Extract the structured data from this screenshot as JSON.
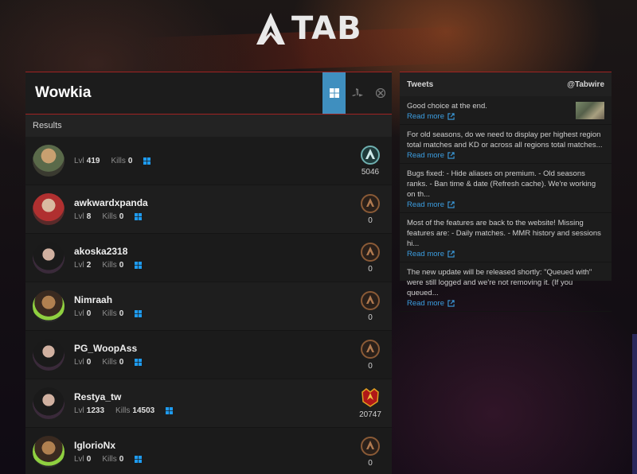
{
  "logo": {
    "text": "TAB"
  },
  "search": {
    "value": "Wowkia",
    "placeholder": ""
  },
  "platforms": [
    {
      "name": "PC",
      "active": true
    },
    {
      "name": "PlayStation",
      "active": false
    },
    {
      "name": "Xbox",
      "active": false
    }
  ],
  "results": {
    "header": "Results",
    "lvl_label": "Lvl",
    "kills_label": "Kills",
    "players": [
      {
        "name": "",
        "lvl": "419",
        "kills": "0",
        "rank": "5046",
        "rank_tier": "master"
      },
      {
        "name": "awkwardxpanda",
        "lvl": "8",
        "kills": "0",
        "rank": "0",
        "rank_tier": "rookie"
      },
      {
        "name": "akoska2318",
        "lvl": "2",
        "kills": "0",
        "rank": "0",
        "rank_tier": "rookie"
      },
      {
        "name": "Nimraah",
        "lvl": "0",
        "kills": "0",
        "rank": "0",
        "rank_tier": "rookie"
      },
      {
        "name": "PG_WoopAss",
        "lvl": "0",
        "kills": "0",
        "rank": "0",
        "rank_tier": "rookie"
      },
      {
        "name": "Restya_tw",
        "lvl": "1233",
        "kills": "14503",
        "rank": "20747",
        "rank_tier": "predator"
      },
      {
        "name": "IglorioNx",
        "lvl": "0",
        "kills": "0",
        "rank": "0",
        "rank_tier": "rookie"
      }
    ]
  },
  "tweets": {
    "title": "Tweets",
    "handle": "@Tabwire",
    "read_more": "Read more",
    "items": [
      {
        "text": "Good choice at the end."
      },
      {
        "text": "For old seasons, do we need to display per highest region total matches and KD or across all regions total matches..."
      },
      {
        "text": "Bugs fixed: - Hide aliases on premium. - Old seasons ranks. - Ban time & date (Refresh cache). We're working on th..."
      },
      {
        "text": "Most of the features are back to the website! Missing features are: - Daily matches. - MMR history and sessions hi..."
      },
      {
        "text": "The new update will be released shortly: \"Queued with\" were still logged and we're not removing it. (If you queued..."
      }
    ]
  },
  "colors": {
    "accent": "#a02323",
    "platform_active": "#3f8fbf",
    "link": "#3b9de0",
    "windows_icon": "#1e9bf0"
  },
  "icons": {
    "platform_pc": "windows-icon",
    "platform_ps": "playstation-icon",
    "platform_xbox": "xbox-icon",
    "external_link": "external-link-icon"
  }
}
